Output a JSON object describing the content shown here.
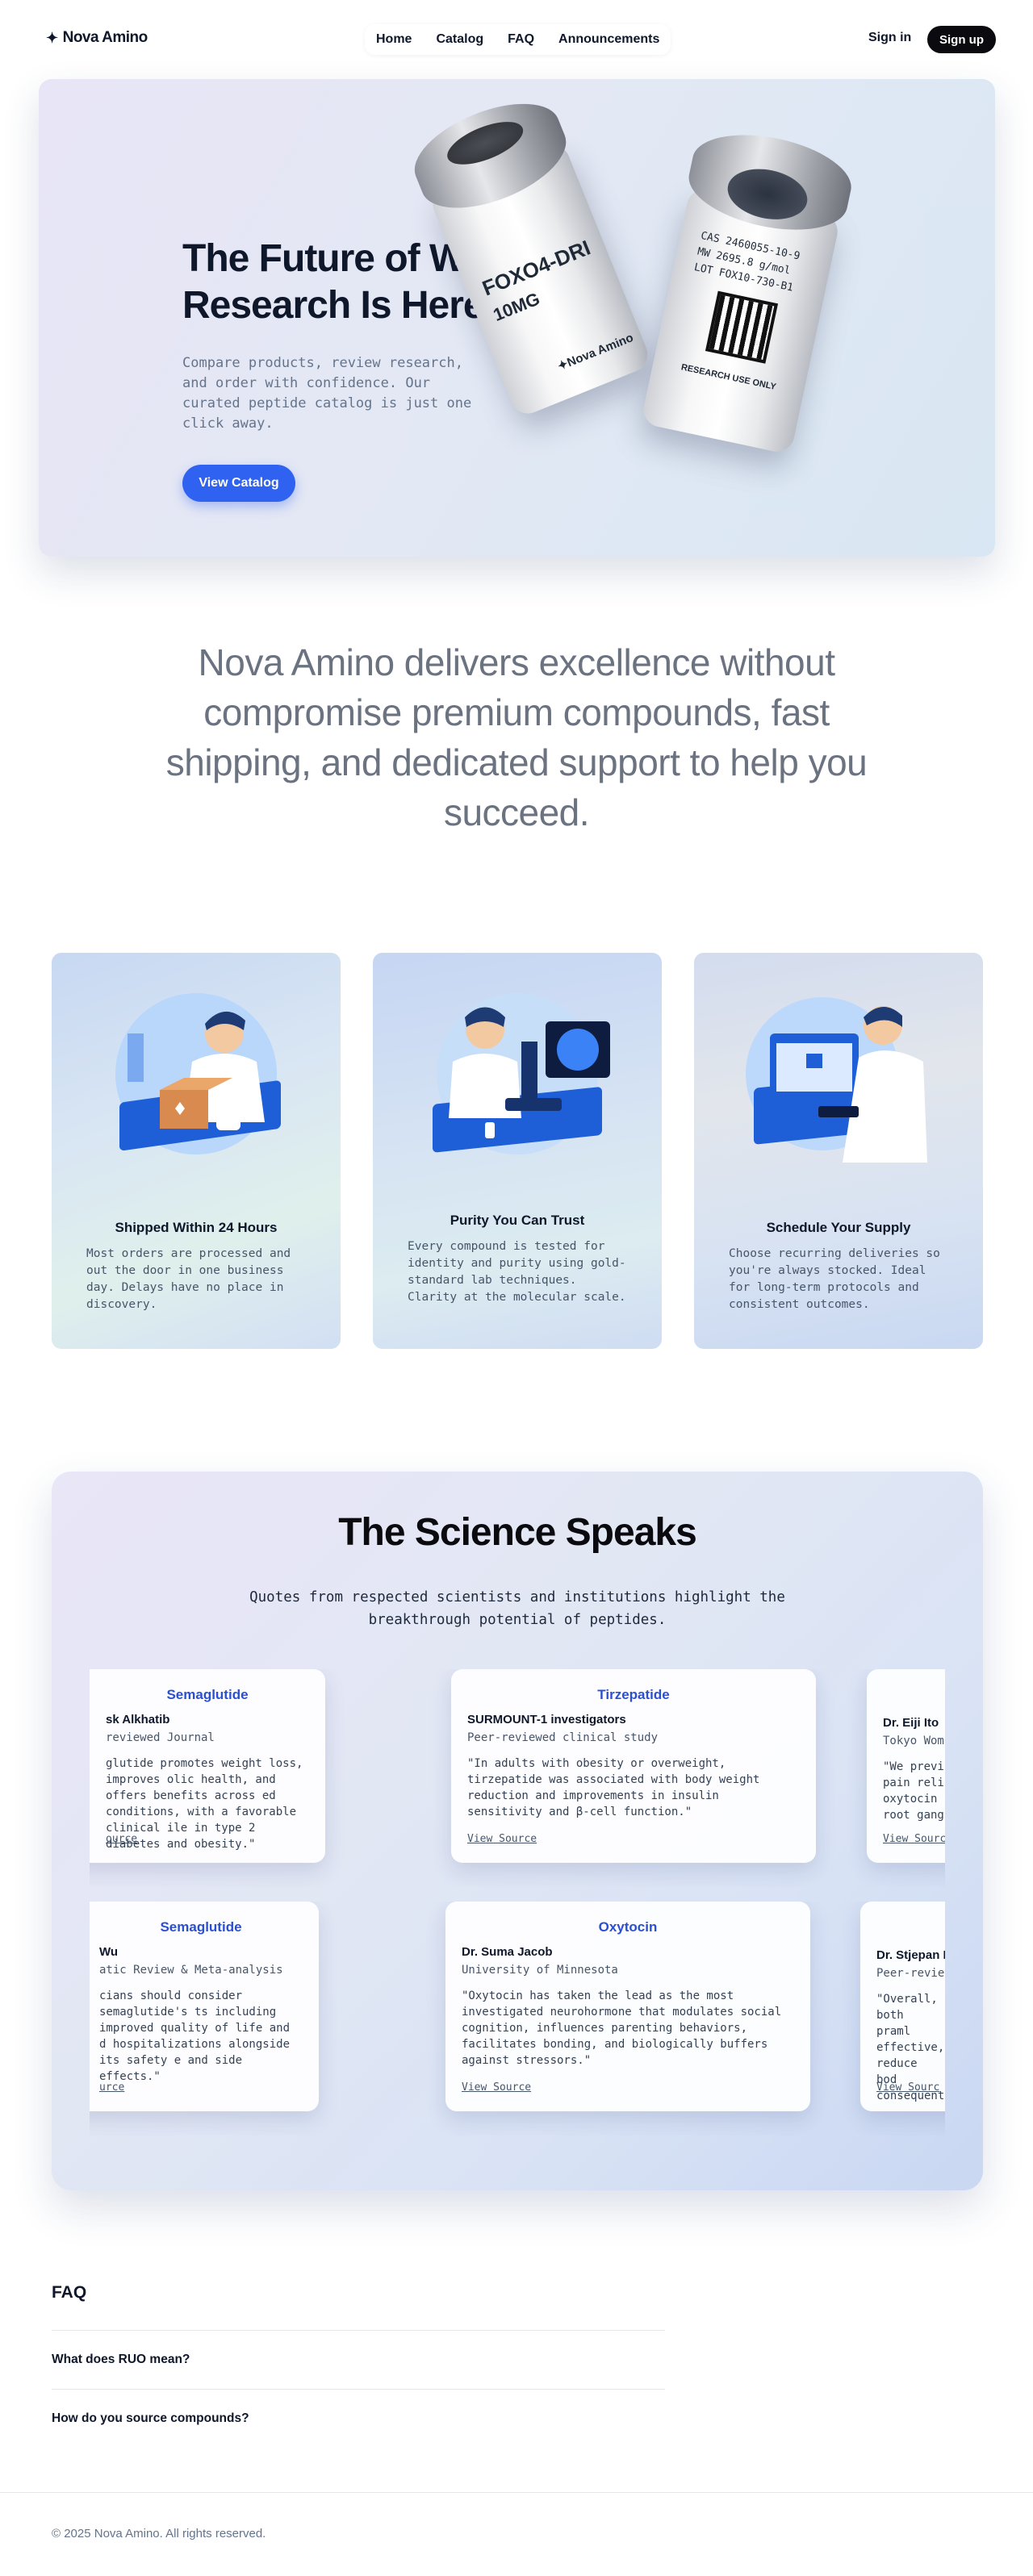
{
  "brand": {
    "name": "Nova Amino",
    "logo_icon": "sparkle-icon"
  },
  "nav": {
    "links": [
      "Home",
      "Catalog",
      "FAQ",
      "Announcements"
    ],
    "sign_in": "Sign in",
    "sign_up": "Sign up"
  },
  "hero": {
    "title": "The Future of Wellness Research Is Here",
    "body": "Compare products, review research, and order with confidence. Our curated peptide catalog is just one click away.",
    "cta": "View Catalog",
    "vial_left": {
      "name": "FOXO4-DRI",
      "dose": "10MG",
      "brand": "✦Nova Amino"
    },
    "vial_right": {
      "cas": "CAS 2460055-10-9",
      "mw": "MW 2695.8 g/mol",
      "lot": "LOT FOX10-730-B1",
      "note": "RESEARCH USE ONLY"
    }
  },
  "statement": "Nova Amino delivers excellence without compromise premium compounds, fast shipping, and dedicated support to help you succeed.",
  "features": [
    {
      "title": "Shipped Within 24 Hours",
      "body": "Most orders are processed and out the door in one business day. Delays have no place in discovery.",
      "icon": "scientist-packing-box-illustration"
    },
    {
      "title": "Purity You Can Trust",
      "body": "Every compound is tested for identity and purity using gold-standard lab techniques. Clarity at the molecular scale.",
      "icon": "scientist-microscope-illustration"
    },
    {
      "title": "Schedule Your Supply",
      "body": "Choose recurring deliveries so you're always stocked. Ideal for long-term protocols and consistent outcomes.",
      "icon": "scientist-calendar-illustration"
    }
  ],
  "science": {
    "title": "The Science Speaks",
    "subtitle": "Quotes from respected scientists and institutions highlight the breakthrough potential of peptides.",
    "row1": [
      {
        "drug": "Semaglutide",
        "author": "sk Alkhatib",
        "source": "reviewed Journal",
        "quote": "glutide promotes weight loss, improves olic health, and offers benefits across ed conditions, with a favorable clinical ile in type 2 diabetes and obesity.\"",
        "link": "ource"
      },
      {
        "drug": "Tirzepatide",
        "author": "SURMOUNT-1 investigators",
        "source": "Peer-reviewed clinical study",
        "quote": "\"In adults with obesity or overweight, tirzepatide was associated with body weight reduction and improvements in insulin sensitivity and β-cell function.\"",
        "link": "View Source"
      },
      {
        "drug": "",
        "author": "Dr. Eiji Ito",
        "source": "Tokyo Wom",
        "quote": "\"We previ pain reli oxytocin root gang",
        "link": "View Sourc"
      }
    ],
    "row2": [
      {
        "drug": "Semaglutide",
        "author": "Wu",
        "source": "atic Review & Meta-analysis",
        "quote": "cians should consider semaglutide's ts including improved quality of life and d hospitalizations alongside its safety e and side effects.\"",
        "link": "urce"
      },
      {
        "drug": "Oxytocin",
        "author": "Dr. Suma Jacob",
        "source": "University of Minnesota",
        "quote": "\"Oxytocin has taken the lead as the most investigated neurohormone that modulates social cognition, influences parenting behaviors, facilitates bonding, and biologically buffers against stressors.\"",
        "link": "View Source"
      },
      {
        "drug": "",
        "author": "Dr. Stjepan I",
        "source": "Peer-revie",
        "quote": "\"Overall, both praml effective, reduce bod consequent",
        "link": "View Sourc"
      }
    ]
  },
  "faq": {
    "title": "FAQ",
    "items": [
      "What does RUO mean?",
      "How do you source compounds?"
    ]
  },
  "footer": {
    "copyright": "© 2025 Nova Amino. All rights reserved."
  }
}
